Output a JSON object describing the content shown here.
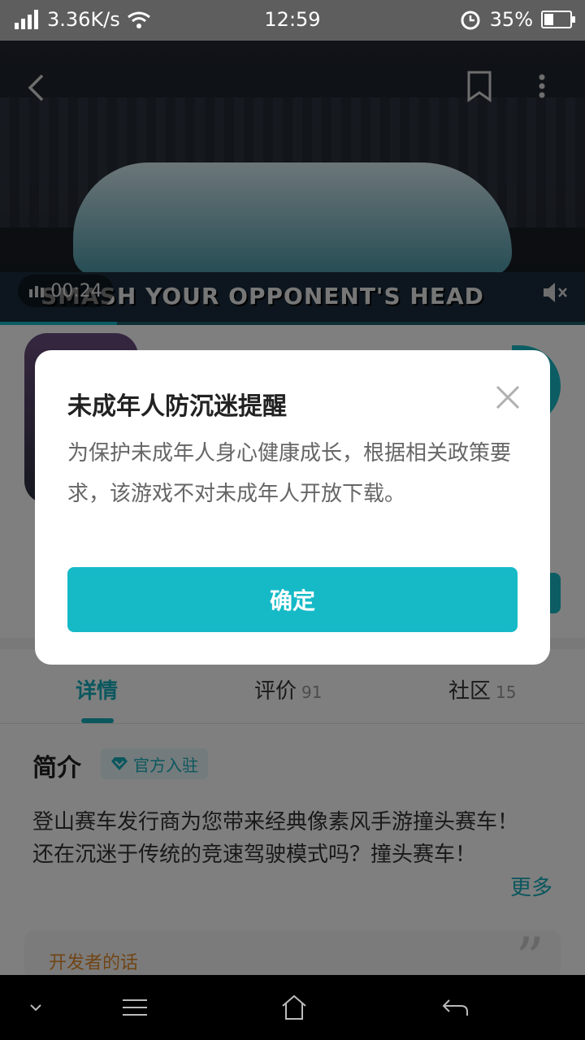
{
  "status_bar": {
    "network_speed": "3.36K/s",
    "time": "12:59",
    "battery_percent": "35%",
    "battery_level": 0.35
  },
  "video": {
    "time": "00:24",
    "caption": "SMASH YOUR OPPONENT'S HEAD",
    "progress": 0.2
  },
  "tabs": [
    {
      "label": "详情",
      "count": ""
    },
    {
      "label": "评价",
      "count": "91"
    },
    {
      "label": "社区",
      "count": "15"
    }
  ],
  "intro": {
    "title": "简介",
    "badge": "官方入驻",
    "line1": "登山赛车发行商为您带来经典像素风手游撞头赛车！",
    "line2": "还在沉迷于传统的竞速驾驶模式吗？撞头赛车！",
    "more": "更多"
  },
  "developer_note": {
    "label": "开发者的话"
  },
  "dialog": {
    "title": "未成年人防沉迷提醒",
    "message": "为保护未成年人身心健康成长，根据相关政策要求，该游戏不对未成年人开放下载。",
    "confirm_label": "确定"
  },
  "colors": {
    "accent": "#16bac7",
    "tab_active": "#16aebd",
    "dev_label": "#e08a2b"
  },
  "icons": {
    "status": [
      "signal-icon",
      "wifi-icon",
      "alarm-icon",
      "battery-icon"
    ],
    "video": [
      "back-icon",
      "bookmark-icon",
      "more-icon",
      "volume-bars-icon",
      "mute-icon"
    ],
    "nav": [
      "chevron-down-icon",
      "menu-icon",
      "home-icon",
      "back-arrow-icon"
    ]
  }
}
